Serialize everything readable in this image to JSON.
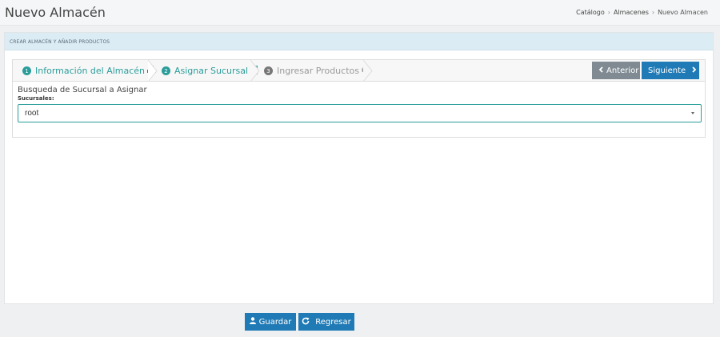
{
  "header": {
    "title": "Nuevo Almacén",
    "breadcrumb": [
      "Catálogo",
      "Almacenes",
      "Nuevo Almacen"
    ]
  },
  "panel": {
    "heading": "CREAR ALMACÉN Y AÑADIR PRODUCTOS"
  },
  "wizard": {
    "steps": [
      {
        "num": "1",
        "label": "Información del Almacén",
        "icon": "cubes-icon",
        "state": "done"
      },
      {
        "num": "2",
        "label": "Asignar Sucursal",
        "icon": "building-icon",
        "state": "active"
      },
      {
        "num": "3",
        "label": "Ingresar Productos",
        "icon": "cube-icon",
        "state": "pending"
      }
    ],
    "prev_label": "Anterior",
    "next_label": "Siguiente",
    "search_title": "Busqueda de Sucursal a Asignar",
    "field_label": "Sucursales:",
    "selected_value": "root"
  },
  "footer": {
    "save_label": "Guardar",
    "back_label": "Regresar"
  },
  "colors": {
    "accent": "#2a9d9a",
    "primary": "#1f7ab5",
    "secondary": "#7f8a92",
    "panel_header": "#dcecf5"
  }
}
